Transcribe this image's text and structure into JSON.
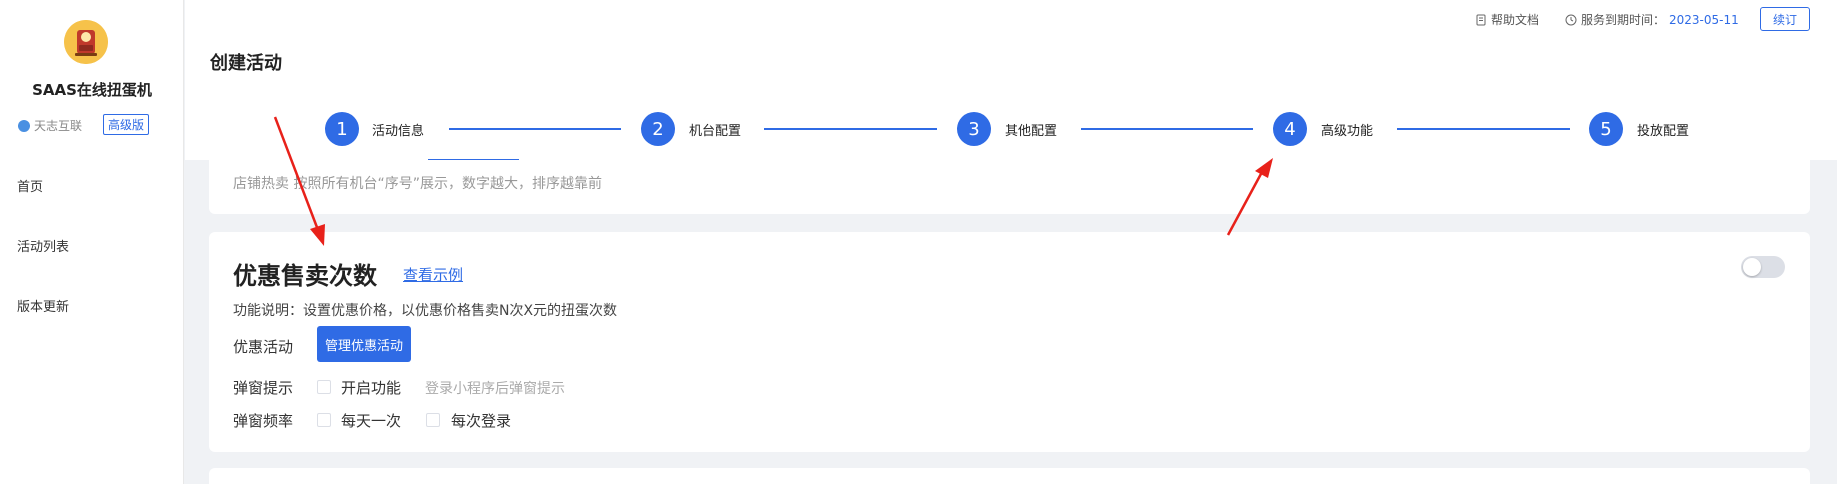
{
  "sidebar": {
    "brand": "SAAS在线扭蛋机",
    "company": "天志互联",
    "tier_badge": "高级版",
    "nav": [
      {
        "label": "首页"
      },
      {
        "label": "活动列表"
      },
      {
        "label": "版本更新"
      }
    ]
  },
  "header": {
    "help_doc": "帮助文档",
    "service_expire_label": "服务到期时间：",
    "service_expire_date": "2023-05-11",
    "renew_label": "续订",
    "page_title": "创建活动"
  },
  "steps": [
    {
      "number": "1",
      "label": "活动信息"
    },
    {
      "number": "2",
      "label": "机台配置"
    },
    {
      "number": "3",
      "label": "其他配置"
    },
    {
      "number": "4",
      "label": "高级功能"
    },
    {
      "number": "5",
      "label": "投放配置"
    }
  ],
  "hot_sale_note": "店铺热卖 按照所有机台“序号”展示，数字越大，排序越靠前",
  "discount_section": {
    "title": "优惠售卖次数",
    "example_link": "查看示例",
    "enabled": false,
    "description": "功能说明：设置优惠价格，以优惠价格售卖N次X元的扭蛋次数",
    "activity_label": "优惠活动",
    "manage_button": "管理优惠活动",
    "popup_label": "弹窗提示",
    "popup_option": "开启功能",
    "popup_hint": "登录小程序后弹窗提示",
    "frequency_label": "弹窗频率",
    "frequency_options": [
      "每天一次",
      "每次登录"
    ]
  },
  "colors": {
    "accent": "#2f6be5",
    "annotation_arrow": "#e8211a"
  }
}
